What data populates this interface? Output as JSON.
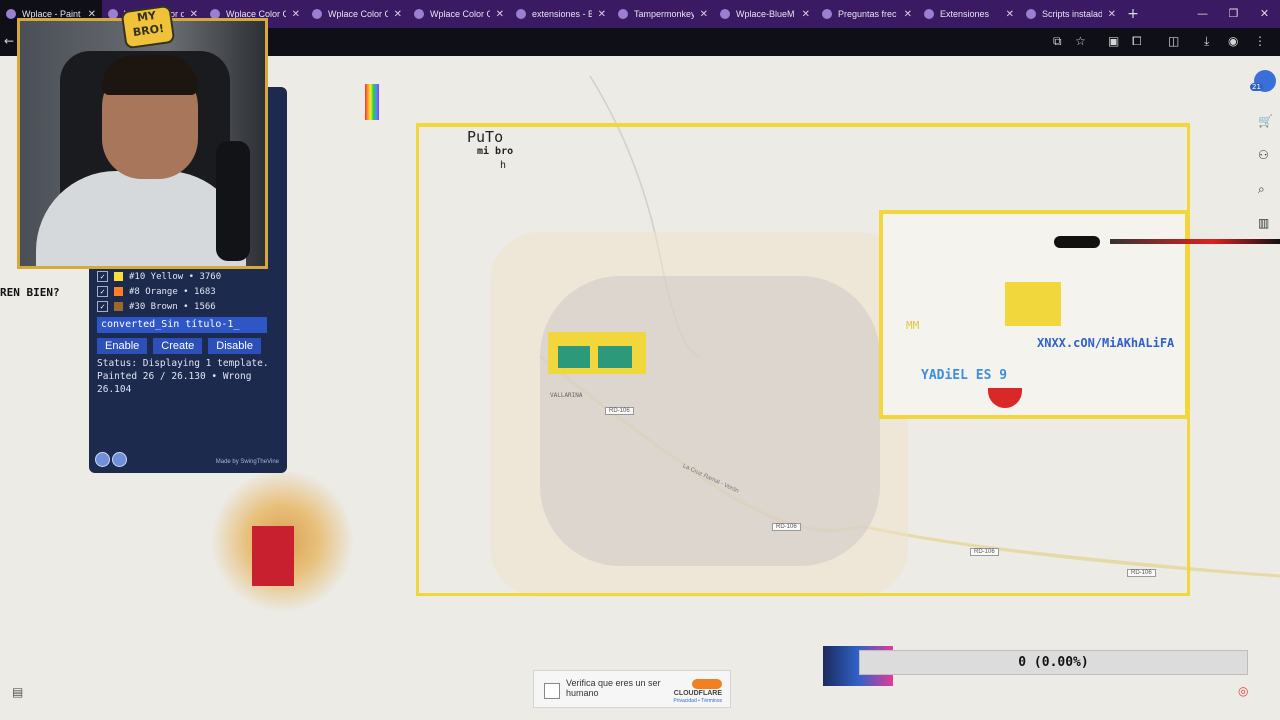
{
  "browser": {
    "tabs": [
      {
        "label": "Wplace - Paint",
        "active": true
      },
      {
        "label": "Wplace Color de"
      },
      {
        "label": "Wplace Color C"
      },
      {
        "label": "Wplace Color C"
      },
      {
        "label": "Wplace Color C"
      },
      {
        "label": "extensiones - B"
      },
      {
        "label": "Tampermonkey"
      },
      {
        "label": "Wplace-BlueM"
      },
      {
        "label": "Preguntas frec"
      },
      {
        "label": "Extensiones"
      },
      {
        "label": "Scripts instalad"
      }
    ],
    "new_tab": "+",
    "close_glyph": "✕",
    "window_controls": {
      "minimize": "—",
      "maximize": "❐",
      "close": "✕"
    }
  },
  "panel": {
    "colors": [
      {
        "label": "#10 Yellow • 3760",
        "hex": "#f9dd3b",
        "checked": "✓"
      },
      {
        "label": "#8 Orange • 1683",
        "hex": "#ff7f27",
        "checked": "✓"
      },
      {
        "label": "#30 Brown • 1566",
        "hex": "#9c6926",
        "checked": "✓"
      }
    ],
    "template_name": "converted_Sin título-1_",
    "enable_label": "Enable",
    "create_label": "Create",
    "disable_label": "Disable",
    "status_line1": "Status: Displaying 1 template.",
    "status_line2": "Painted 26 / 26.130 • Wrong",
    "status_line3": "26.104",
    "made_by": "Made by SwingTheVine"
  },
  "webcam": {
    "badge": "MY BRO!",
    "side_text": "REN BIEN?"
  },
  "map": {
    "pixel_texts": {
      "puto": "PuTo",
      "mibro": "mi bro",
      "h": "h",
      "mm": "MM",
      "xnxx": "XNXX.cON/MiAKhALiFA",
      "yadiel": "YADiEL ES 9",
      "vallarina": "VALLARINA"
    },
    "road_labels": [
      "RD-106",
      "RD-106",
      "RD-106",
      "RD-106"
    ],
    "road_name": "La Cruz Ramal - Verón"
  },
  "progress": {
    "text": "0 (0.00%)"
  },
  "captcha": {
    "text": "Verifica que eres un ser humano",
    "brand": "CLOUDFLARE",
    "links": "Privacidad • Términos"
  },
  "rail": {
    "badge_count": "21"
  }
}
